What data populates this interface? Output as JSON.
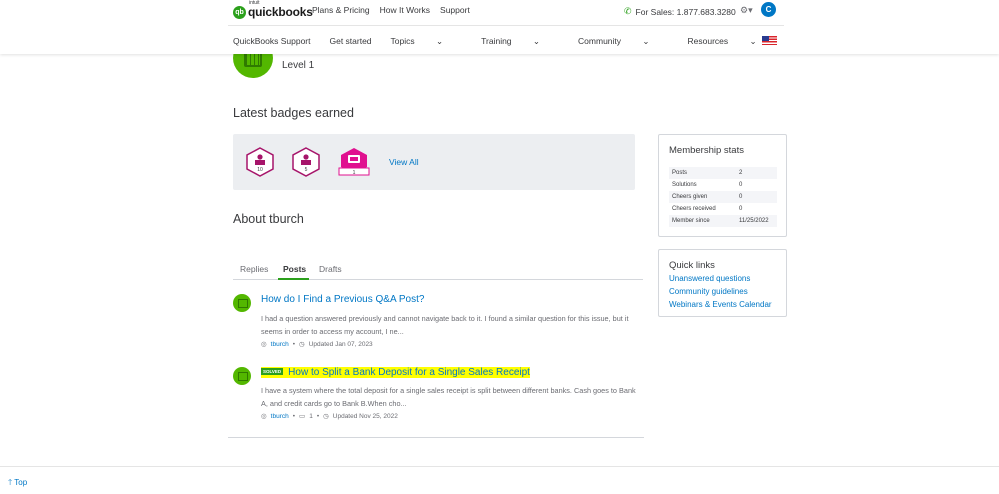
{
  "header": {
    "logo_small": "intuit",
    "logo_text": "quickbooks",
    "top_links": [
      "Plans & Pricing",
      "How It Works",
      "Support"
    ],
    "sales_text": "For Sales: 1.877.683.3280",
    "avatar_initial": "C",
    "nav_items": [
      "QuickBooks Support",
      "Get started",
      "Topics",
      "Training",
      "Community",
      "Resources"
    ]
  },
  "profile": {
    "level": "Level 1",
    "badges_heading": "Latest badges earned",
    "badges": [
      {
        "name": "badge-10",
        "count": "10",
        "color": "#a6146a"
      },
      {
        "name": "badge-5",
        "count": "5",
        "color": "#a6146a"
      },
      {
        "name": "badge-1",
        "count": "1",
        "color": "#e0108f"
      }
    ],
    "view_all": "View All",
    "about_heading": "About tburch",
    "tabs": [
      "Replies",
      "Posts",
      "Drafts"
    ],
    "active_tab": "Posts"
  },
  "posts": [
    {
      "title": "How do I Find a Previous Q&A Post?",
      "solved": false,
      "body": "I had a question answered previously and cannot navigate back to it. I found a similar question for this issue, but it seems in order to access my account, I ne...",
      "author": "tburch",
      "replies": "",
      "updated": "Updated Jan 07, 2023"
    },
    {
      "title": "How to Split a Bank Deposit for a Single Sales Receipt",
      "solved": true,
      "solved_label": "SOLVED",
      "body": "I have a system where the total deposit for a single sales receipt is split between different banks. Cash goes to Bank A, and credit cards go to Bank B.When cho...",
      "author": "tburch",
      "replies": "1",
      "updated": "Updated Nov 25, 2022"
    }
  ],
  "membership": {
    "title": "Membership stats",
    "rows": [
      {
        "label": "Posts",
        "value": "2"
      },
      {
        "label": "Solutions",
        "value": "0"
      },
      {
        "label": "Cheers given",
        "value": "0"
      },
      {
        "label": "Cheers received",
        "value": "0"
      },
      {
        "label": "Member since",
        "value": "11/25/2022"
      }
    ]
  },
  "quick_links": {
    "title": "Quick links",
    "links": [
      "Unanswered questions",
      "Community guidelines",
      "Webinars & Events Calendar"
    ]
  },
  "footer": {
    "top_label": "Top"
  },
  "colors": {
    "brand_green": "#2ca01c",
    "link_blue": "#0077c5",
    "badge_magenta": "#a6146a"
  }
}
